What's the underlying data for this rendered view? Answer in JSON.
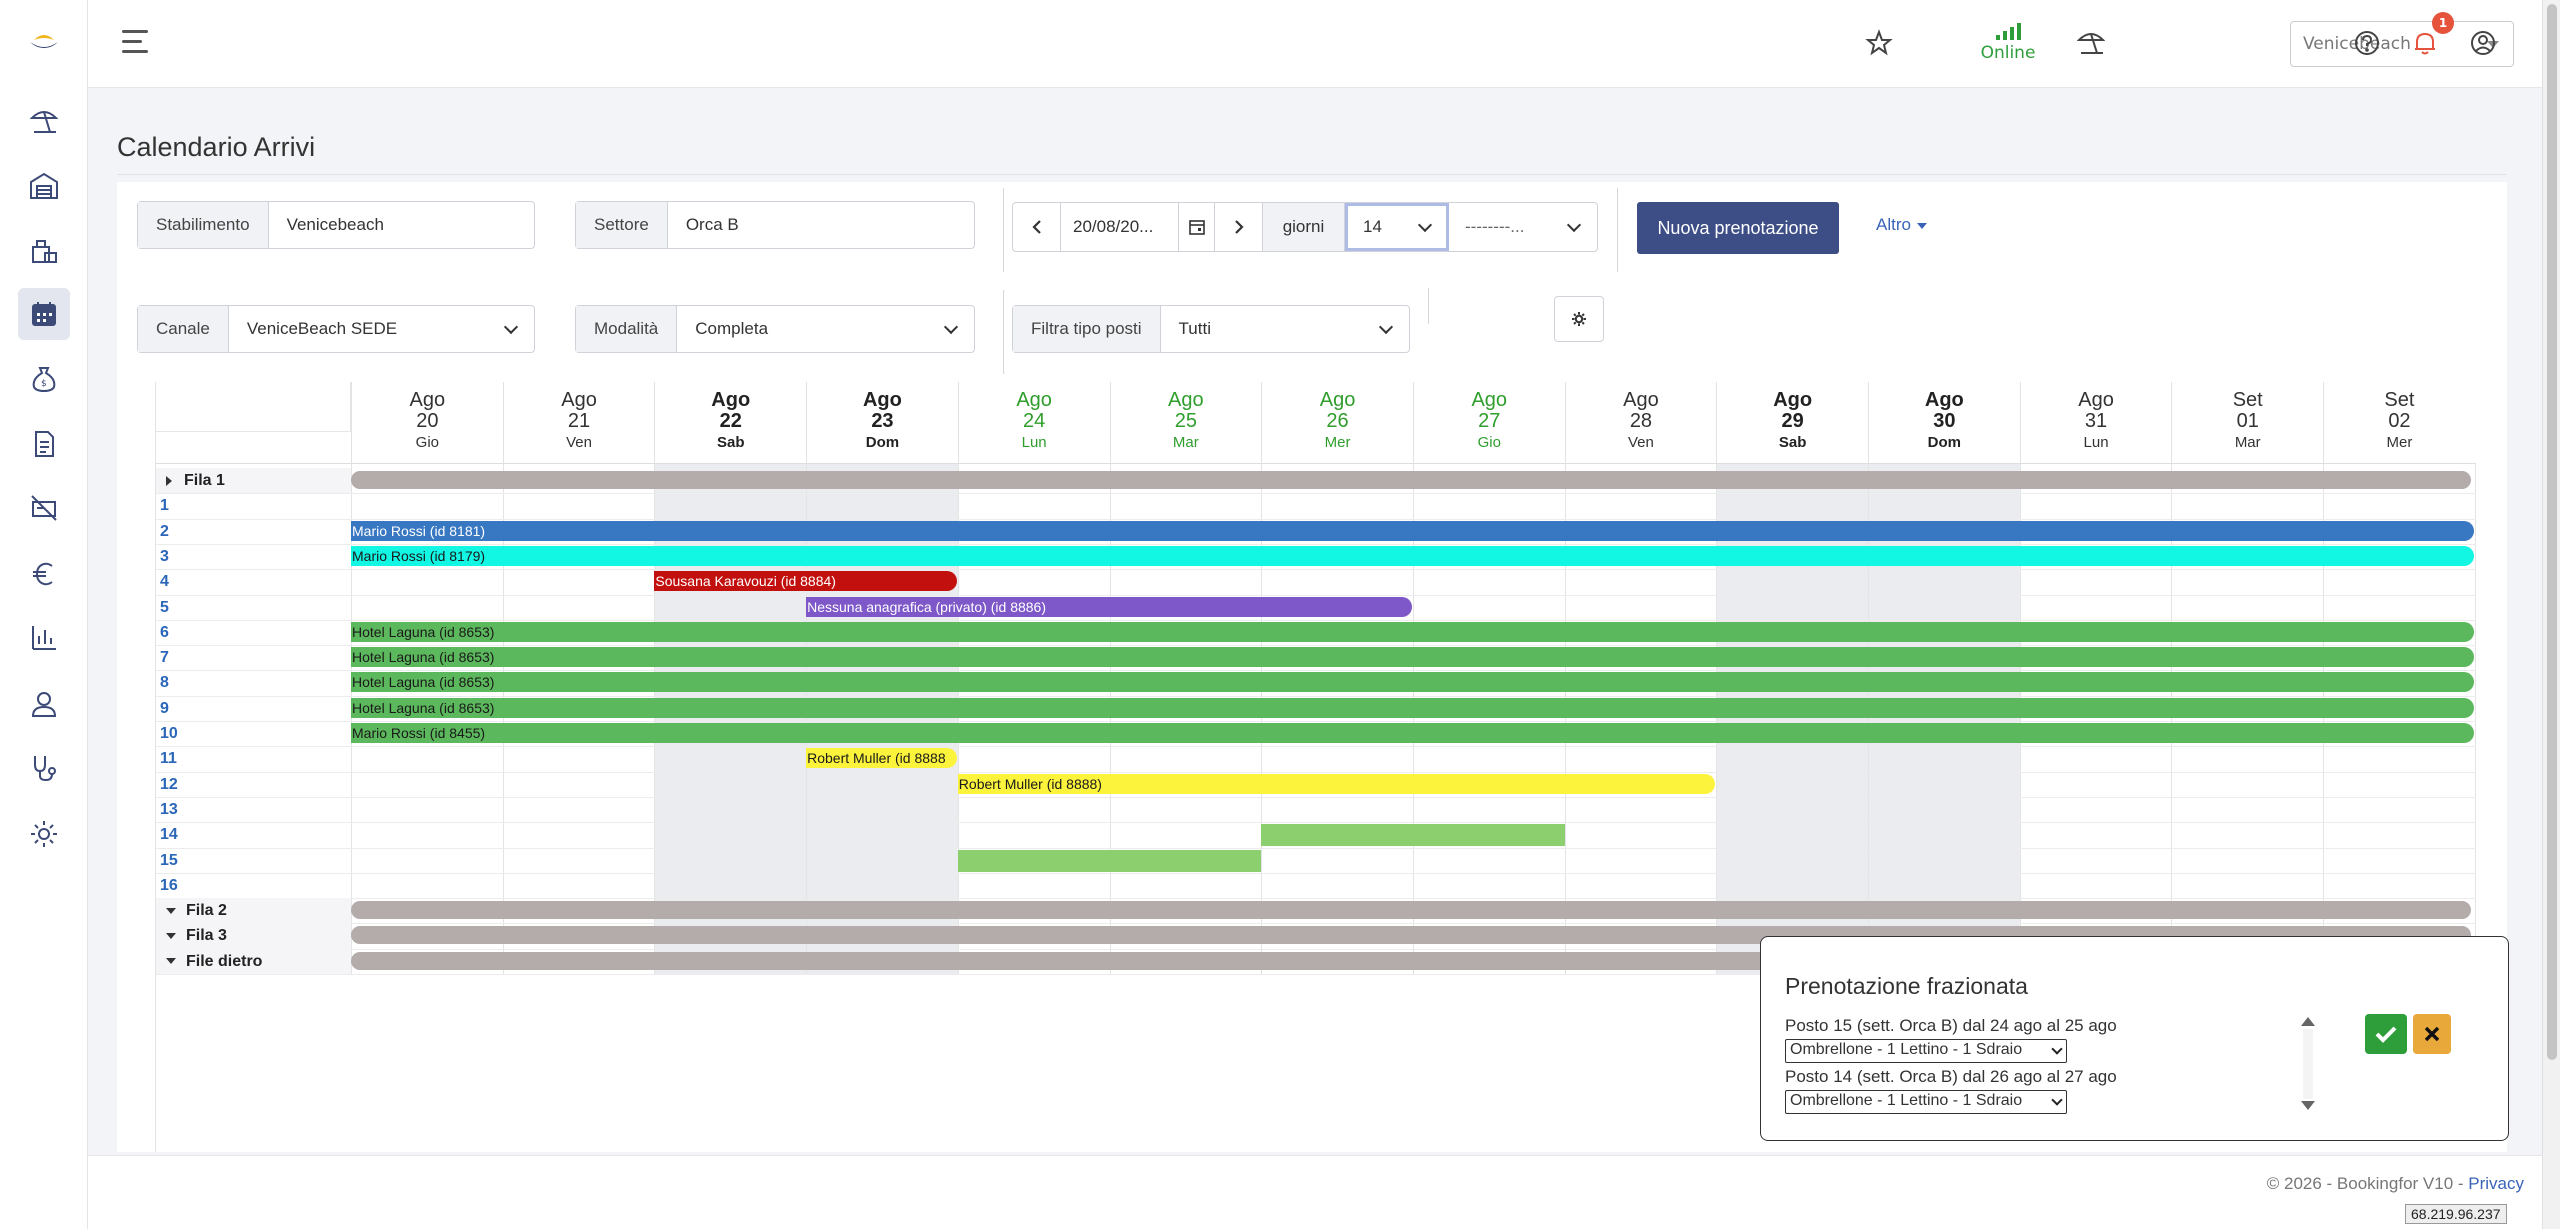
{
  "sidebar": {
    "logo": "bookingfor-logo",
    "items": [
      {
        "icon": "beach-umbrella-icon"
      },
      {
        "icon": "warehouse-icon"
      },
      {
        "icon": "luggage-icon"
      },
      {
        "icon": "calendar-icon",
        "active": true
      },
      {
        "icon": "money-bag-icon"
      },
      {
        "icon": "document-icon"
      },
      {
        "icon": "no-cart-icon"
      },
      {
        "icon": "euro-icon"
      },
      {
        "icon": "chart-icon"
      },
      {
        "icon": "user-icon"
      },
      {
        "icon": "stethoscope-icon"
      },
      {
        "icon": "gear-icon"
      }
    ]
  },
  "topbar": {
    "status": "Online",
    "site": "Venicebeach",
    "notification_count": "1"
  },
  "page": {
    "title": "Calendario Arrivi"
  },
  "filters": {
    "stabilimento": {
      "label": "Stabilimento",
      "value": "Venicebeach"
    },
    "settore": {
      "label": "Settore",
      "value": "Orca B"
    },
    "date": "20/08/20...",
    "giorni_label": "giorni",
    "giorni_value": "14",
    "extra_value": "--------...",
    "nuova_label": "Nuova prenotazione",
    "altro_label": "Altro",
    "canale": {
      "label": "Canale",
      "value": "VeniceBeach SEDE"
    },
    "modalita": {
      "label": "Modalità",
      "value": "Completa"
    },
    "tipo_posti": {
      "label": "Filtra tipo posti",
      "value": "Tutti"
    }
  },
  "calendar": {
    "days": [
      {
        "m": "Ago",
        "d": "20",
        "w": "Gio",
        "style": "norm"
      },
      {
        "m": "Ago",
        "d": "21",
        "w": "Ven",
        "style": "norm"
      },
      {
        "m": "Ago",
        "d": "22",
        "w": "Sab",
        "style": "bold"
      },
      {
        "m": "Ago",
        "d": "23",
        "w": "Dom",
        "style": "bold"
      },
      {
        "m": "Ago",
        "d": "24",
        "w": "Lun",
        "style": "green"
      },
      {
        "m": "Ago",
        "d": "25",
        "w": "Mar",
        "style": "green"
      },
      {
        "m": "Ago",
        "d": "26",
        "w": "Mer",
        "style": "green"
      },
      {
        "m": "Ago",
        "d": "27",
        "w": "Gio",
        "style": "green"
      },
      {
        "m": "Ago",
        "d": "28",
        "w": "Ven",
        "style": "norm"
      },
      {
        "m": "Ago",
        "d": "29",
        "w": "Sab",
        "style": "bold"
      },
      {
        "m": "Ago",
        "d": "30",
        "w": "Dom",
        "style": "bold"
      },
      {
        "m": "Ago",
        "d": "31",
        "w": "Lun",
        "style": "norm"
      },
      {
        "m": "Set",
        "d": "01",
        "w": "Mar",
        "style": "norm"
      },
      {
        "m": "Set",
        "d": "02",
        "w": "Mer",
        "style": "norm"
      }
    ],
    "weekend_cols": [
      2,
      3,
      9,
      10
    ],
    "rows": [
      {
        "type": "group",
        "label": "Fila 1",
        "open": true
      },
      {
        "type": "num",
        "label": "1"
      },
      {
        "type": "num",
        "label": "2"
      },
      {
        "type": "num",
        "label": "3"
      },
      {
        "type": "num",
        "label": "4"
      },
      {
        "type": "num",
        "label": "5"
      },
      {
        "type": "num",
        "label": "6"
      },
      {
        "type": "num",
        "label": "7"
      },
      {
        "type": "num",
        "label": "8"
      },
      {
        "type": "num",
        "label": "9"
      },
      {
        "type": "num",
        "label": "10"
      },
      {
        "type": "num",
        "label": "11"
      },
      {
        "type": "num",
        "label": "12"
      },
      {
        "type": "num",
        "label": "13"
      },
      {
        "type": "num",
        "label": "14"
      },
      {
        "type": "num",
        "label": "15"
      },
      {
        "type": "num",
        "label": "16"
      },
      {
        "type": "group",
        "label": "Fila 2",
        "open": false
      },
      {
        "type": "group",
        "label": "Fila 3",
        "open": false
      },
      {
        "type": "group",
        "label": "File dietro",
        "open": false
      }
    ],
    "bookings": [
      {
        "row": 2,
        "start": 0,
        "end": 14,
        "label": "Mario Rossi (id 8181)",
        "color": "#3877c2",
        "text": "#ffffff"
      },
      {
        "row": 3,
        "start": 0,
        "end": 14,
        "label": "Mario Rossi (id 8179)",
        "color": "#12f6e4",
        "text": "#1a1a1a"
      },
      {
        "row": 4,
        "start": 2,
        "end": 4,
        "label": "Sousana Karavouzi (id 8884)",
        "color": "#c2100f",
        "text": "#ffffff"
      },
      {
        "row": 5,
        "start": 3,
        "end": 7,
        "label": "Nessuna anagrafica (privato) (id 8886)",
        "color": "#7e57c8",
        "text": "#ffffff"
      },
      {
        "row": 6,
        "start": 0,
        "end": 14,
        "label": "Hotel Laguna (id 8653)",
        "color": "#5cb85c",
        "text": "#1a1a1a"
      },
      {
        "row": 7,
        "start": 0,
        "end": 14,
        "label": "Hotel Laguna (id 8653)",
        "color": "#5cb85c",
        "text": "#1a1a1a"
      },
      {
        "row": 8,
        "start": 0,
        "end": 14,
        "label": "Hotel Laguna (id 8653)",
        "color": "#5cb85c",
        "text": "#1a1a1a"
      },
      {
        "row": 9,
        "start": 0,
        "end": 14,
        "label": "Hotel Laguna (id 8653)",
        "color": "#5cb85c",
        "text": "#1a1a1a"
      },
      {
        "row": 10,
        "start": 0,
        "end": 14,
        "label": "Mario Rossi (id 8455)",
        "color": "#5cb85c",
        "text": "#1a1a1a"
      },
      {
        "row": 11,
        "start": 3,
        "end": 4,
        "label": "Robert Muller (id 8888",
        "color": "#fcf43c",
        "text": "#1a1a1a"
      },
      {
        "row": 12,
        "start": 4,
        "end": 9,
        "label": "Robert Muller (id 8888)",
        "color": "#fcf43c",
        "text": "#1a1a1a"
      },
      {
        "row": 14,
        "start": 6,
        "end": 8,
        "label": "",
        "color": "#8ccf6f",
        "text": "#1a1a1a",
        "square": true
      },
      {
        "row": 15,
        "start": 4,
        "end": 6,
        "label": "",
        "color": "#8ccf6f",
        "text": "#1a1a1a",
        "square": true
      }
    ]
  },
  "popup": {
    "title": "Prenotazione frazionata",
    "line1": "Posto 15 (sett. Orca B) dal 24 ago al 25 ago",
    "select1": "Ombrellone - 1 Lettino - 1 Sdraio",
    "line2": "Posto 14 (sett. Orca B) dal 26 ago al 27 ago",
    "select2": "Ombrellone - 1 Lettino - 1 Sdraio"
  },
  "footer": {
    "copyright": "© 2026 - Bookingfor V10 - ",
    "privacy": "Privacy",
    "ip": "68.219.96.237"
  }
}
